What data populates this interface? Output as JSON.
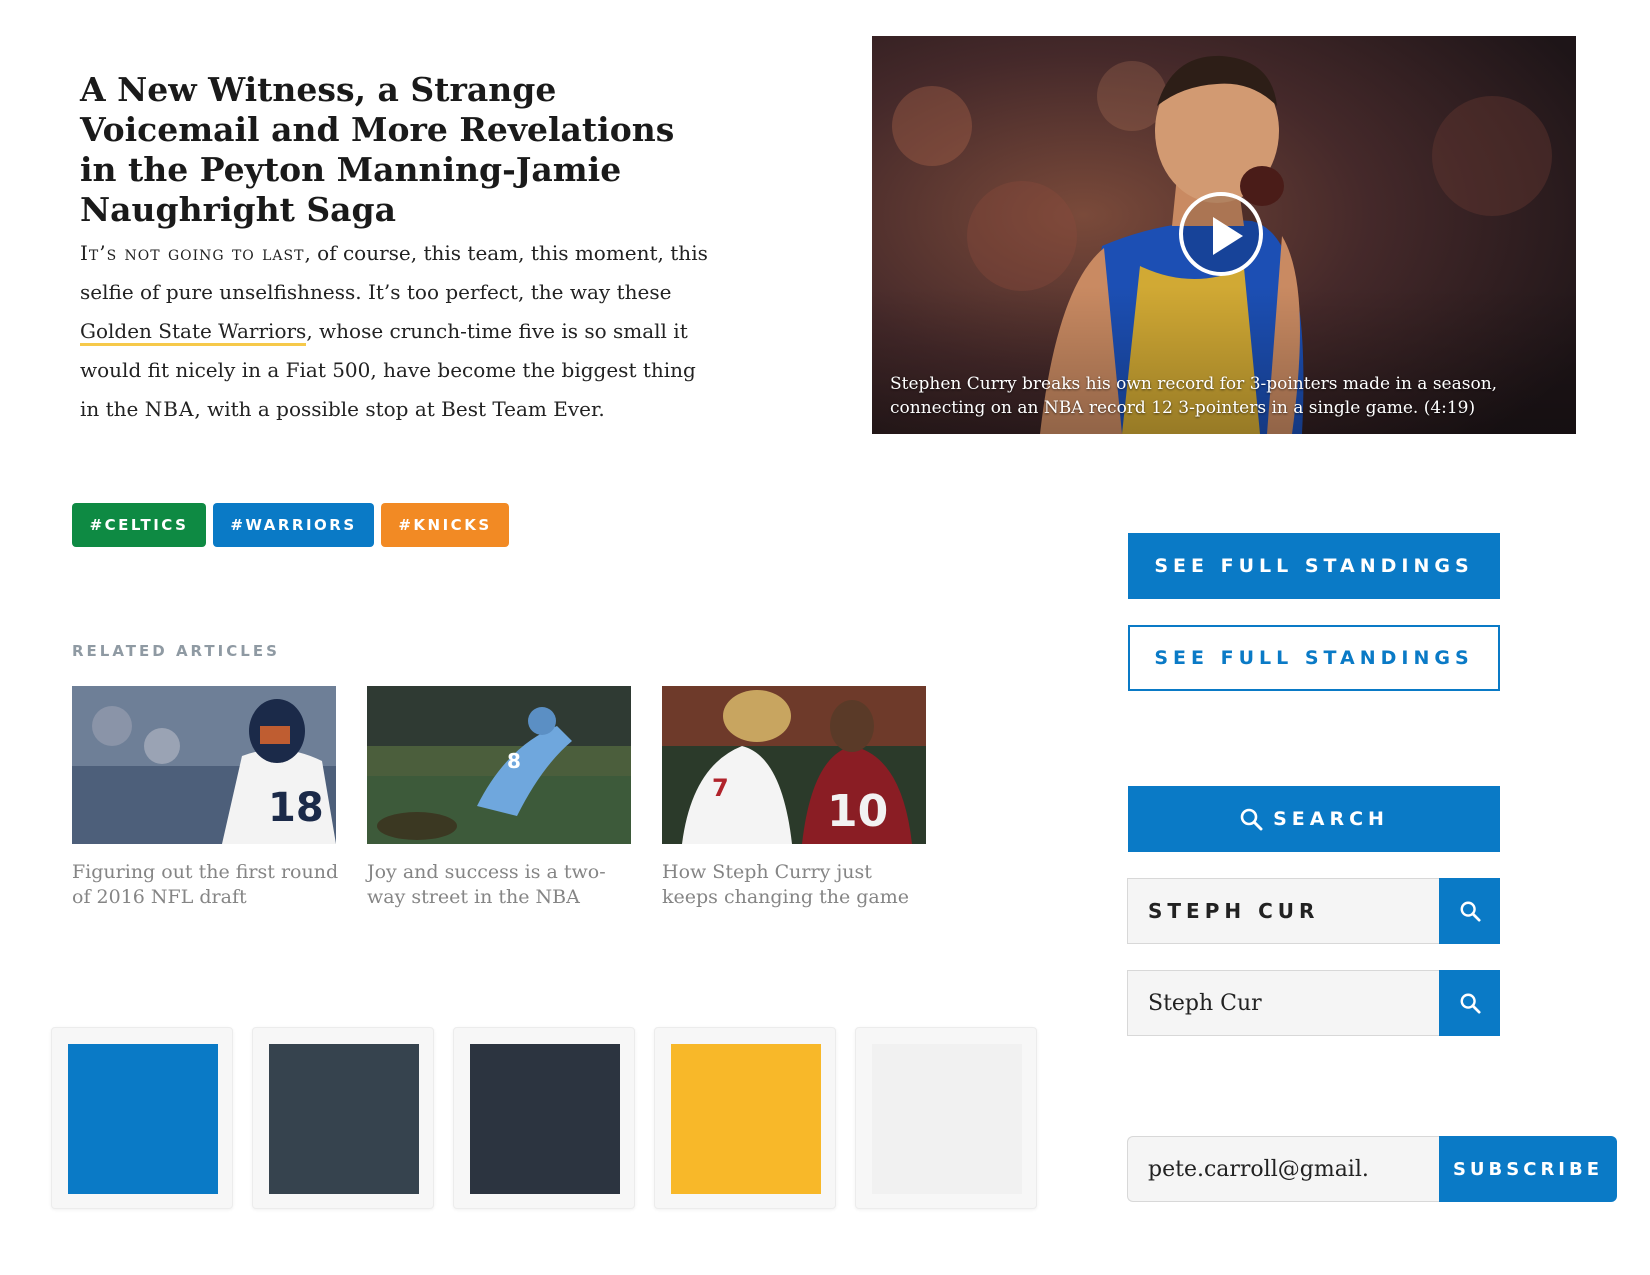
{
  "article": {
    "headline": "A New Witness, a Strange Voicemail and More Revelations in the Peyton Manning-Jamie Naughright Saga",
    "lede_smallcaps": "It’s not going to last",
    "lede_part1": ", of course, this team, this moment, this selfie of pure unselfishness. It’s too perfect, the way these ",
    "lede_link": "Golden State Warriors",
    "lede_part2": ", whose crunch-time five is so small it would fit nicely in a Fiat 500, have become the biggest thing in the ",
    "lede_nba": "NBA",
    "lede_part3": ", with a possible stop at Best Team Ever."
  },
  "video": {
    "caption": "Stephen Curry breaks his own record for 3-pointers made in a season, connecting on an NBA record 12 3-pointers in a single game. (4:19)",
    "play_icon": "play-icon"
  },
  "tags": [
    {
      "label": "#CELTICS",
      "color": "#0e8a43"
    },
    {
      "label": "#WARRIORS",
      "color": "#0a7ac6"
    },
    {
      "label": "#KNICKS",
      "color": "#f28a24"
    }
  ],
  "related": {
    "label": "RELATED ARTICLES",
    "items": [
      {
        "title": "Figuring out the first round of 2016 NFL draft"
      },
      {
        "title": "Joy and success is a two-way street in the NBA"
      },
      {
        "title": "How Steph Curry just keeps changing the game"
      }
    ]
  },
  "swatches": [
    {
      "color": "#0a7ac6"
    },
    {
      "color": "#36434e"
    },
    {
      "color": "#2c3440"
    },
    {
      "color": "#f8b829"
    },
    {
      "color": "#f1f1f1"
    }
  ],
  "buttons": {
    "standings_primary": "SEE FULL STANDINGS",
    "standings_outline": "SEE FULL STANDINGS",
    "search": "SEARCH",
    "search_icon": "search-icon"
  },
  "search_fields": {
    "caps_value": "STEPH CUR",
    "serif_value": "Steph Cur"
  },
  "subscribe": {
    "email_value": "pete.carroll@gmail.c",
    "button_label": "SUBSCRIBE"
  },
  "colors": {
    "brand_blue": "#0a7ac6",
    "link_underline": "#f6c94a",
    "muted_gray": "#8f9aa3"
  }
}
